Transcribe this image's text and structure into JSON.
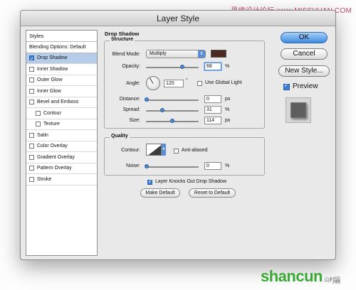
{
  "watermark_top": "思缘设计论坛 www.MISSVUAN.COM",
  "watermark_bottom": {
    "brand": "shancun",
    "suffix": "山村网",
    "domain": ".net"
  },
  "dialog": {
    "title": "Layer Style"
  },
  "left_panel": {
    "header": "Styles",
    "blending": "Blending Options: Default",
    "items": [
      {
        "label": "Drop Shadow",
        "checked": true,
        "selected": true
      },
      {
        "label": "Inner Shadow",
        "checked": false
      },
      {
        "label": "Outer Glow",
        "checked": false
      },
      {
        "label": "Inner Glow",
        "checked": false
      },
      {
        "label": "Bevel and Emboss",
        "checked": false
      },
      {
        "label": "Contour",
        "checked": false,
        "sub": true
      },
      {
        "label": "Texture",
        "checked": false,
        "sub": true
      },
      {
        "label": "Satin",
        "checked": false
      },
      {
        "label": "Color Overlay",
        "checked": false
      },
      {
        "label": "Gradient Overlay",
        "checked": false
      },
      {
        "label": "Pattern Overlay",
        "checked": false
      },
      {
        "label": "Stroke",
        "checked": false
      }
    ]
  },
  "drop_shadow": {
    "title": "Drop Shadow",
    "structure": {
      "title": "Structure",
      "blend_mode_label": "Blend Mode:",
      "blend_mode_value": "Multiply",
      "shadow_color": "#4a2a22",
      "opacity_label": "Opacity:",
      "opacity_value": "68",
      "opacity_unit": "%",
      "angle_label": "Angle:",
      "angle_value": "120",
      "angle_unit": "°",
      "use_global_light": "Use Global Light",
      "distance_label": "Distance:",
      "distance_value": "0",
      "distance_unit": "px",
      "spread_label": "Spread:",
      "spread_value": "31",
      "spread_unit": "%",
      "size_label": "Size:",
      "size_value": "114",
      "size_unit": "px"
    },
    "quality": {
      "title": "Quality",
      "contour_label": "Contour:",
      "anti_aliased": "Anti-aliased",
      "noise_label": "Noise:",
      "noise_value": "0",
      "noise_unit": "%"
    },
    "knockout_label": "Layer Knocks Out Drop Shadow",
    "make_default": "Make Default",
    "reset_default": "Reset to Default"
  },
  "buttons": {
    "ok": "OK",
    "cancel": "Cancel",
    "new_style": "New Style...",
    "preview": "Preview"
  }
}
